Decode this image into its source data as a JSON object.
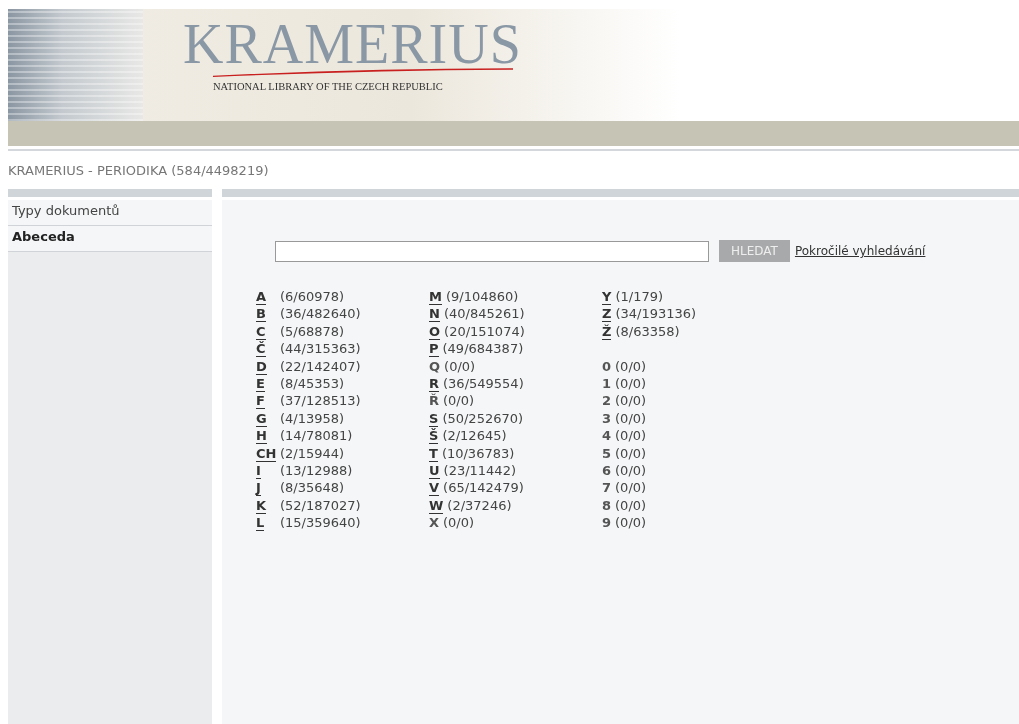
{
  "header": {
    "logo": "KRAMERIUS",
    "tagline": "NATIONAL LIBRARY OF THE CZECH REPUBLIC"
  },
  "page_title": "KRAMERIUS - PERIODIKA (584/4498219)",
  "sidebar": {
    "items": [
      {
        "label": "Typy dokumentů",
        "selected": false
      },
      {
        "label": "Abeceda",
        "selected": true
      }
    ]
  },
  "search": {
    "button": "HLEDAT",
    "advanced_link": "Pokročilé vyhledávání"
  },
  "index": {
    "columns": [
      {
        "groups": [
          [
            {
              "letter": "A",
              "count": "(6/60978)",
              "linked": true
            },
            {
              "letter": "B",
              "count": "(36/482640)",
              "linked": true
            },
            {
              "letter": "C",
              "count": "(5/68878)",
              "linked": true
            },
            {
              "letter": "Č",
              "count": "(44/315363)",
              "linked": true
            },
            {
              "letter": "D",
              "count": "(22/142407)",
              "linked": true
            },
            {
              "letter": "E",
              "count": "(8/45353)",
              "linked": true
            },
            {
              "letter": "F",
              "count": "(37/128513)",
              "linked": true
            },
            {
              "letter": "G",
              "count": "(4/13958)",
              "linked": true
            },
            {
              "letter": "H",
              "count": "(14/78081)",
              "linked": true
            },
            {
              "letter": "CH",
              "count": "(2/15944)",
              "linked": true
            },
            {
              "letter": "I",
              "count": "(13/12988)",
              "linked": true
            },
            {
              "letter": "J",
              "count": "(8/35648)",
              "linked": true
            },
            {
              "letter": "K",
              "count": "(52/187027)",
              "linked": true
            },
            {
              "letter": "L",
              "count": "(15/359640)",
              "linked": true
            }
          ]
        ]
      },
      {
        "groups": [
          [
            {
              "letter": "M",
              "count": "(9/104860)",
              "linked": true
            },
            {
              "letter": "N",
              "count": "(40/845261)",
              "linked": true
            },
            {
              "letter": "O",
              "count": "(20/151074)",
              "linked": true
            },
            {
              "letter": "P",
              "count": "(49/684387)",
              "linked": true
            },
            {
              "letter": "Q",
              "count": "(0/0)",
              "linked": false
            },
            {
              "letter": "R",
              "count": "(36/549554)",
              "linked": true
            },
            {
              "letter": "Ř",
              "count": "(0/0)",
              "linked": false
            },
            {
              "letter": "S",
              "count": "(50/252670)",
              "linked": true
            },
            {
              "letter": "Š",
              "count": "(2/12645)",
              "linked": true
            },
            {
              "letter": "T",
              "count": "(10/36783)",
              "linked": true
            },
            {
              "letter": "U",
              "count": "(23/11442)",
              "linked": true
            },
            {
              "letter": "V",
              "count": "(65/142479)",
              "linked": true
            },
            {
              "letter": "W",
              "count": "(2/37246)",
              "linked": true
            },
            {
              "letter": "X",
              "count": "(0/0)",
              "linked": false
            }
          ]
        ]
      },
      {
        "groups": [
          [
            {
              "letter": "Y",
              "count": "(1/179)",
              "linked": true
            },
            {
              "letter": "Z",
              "count": "(34/193136)",
              "linked": true
            },
            {
              "letter": "Ž",
              "count": "(8/63358)",
              "linked": true
            }
          ],
          [
            {
              "letter": "0",
              "count": "(0/0)",
              "linked": false
            },
            {
              "letter": "1",
              "count": "(0/0)",
              "linked": false
            },
            {
              "letter": "2",
              "count": "(0/0)",
              "linked": false
            },
            {
              "letter": "3",
              "count": "(0/0)",
              "linked": false
            },
            {
              "letter": "4",
              "count": "(0/0)",
              "linked": false
            },
            {
              "letter": "5",
              "count": "(0/0)",
              "linked": false
            },
            {
              "letter": "6",
              "count": "(0/0)",
              "linked": false
            },
            {
              "letter": "7",
              "count": "(0/0)",
              "linked": false
            },
            {
              "letter": "8",
              "count": "(0/0)",
              "linked": false
            },
            {
              "letter": "9",
              "count": "(0/0)",
              "linked": false
            }
          ]
        ]
      }
    ]
  }
}
